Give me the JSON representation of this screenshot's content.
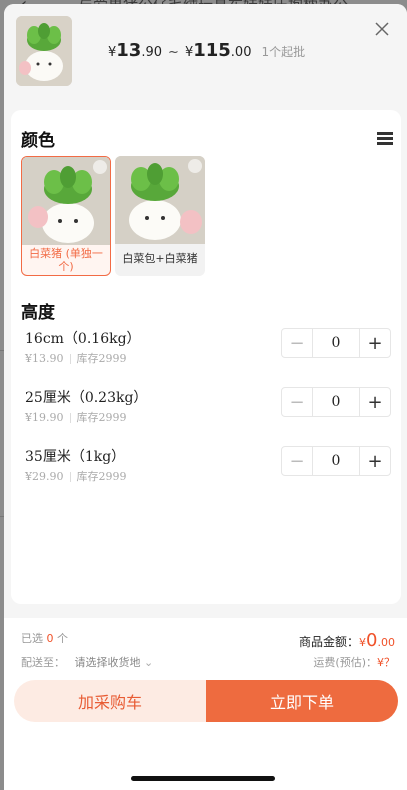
{
  "background": {
    "title": "与爱果猪公仔毛绒玩具布娃娃压抱枕办公..."
  },
  "header": {
    "price_min_symbol": "¥",
    "price_min_int": "13",
    "price_min_dec": ".90",
    "price_sep": "~",
    "price_max_symbol": "¥",
    "price_max_int": "115",
    "price_max_dec": ".00",
    "moq": "1个起批"
  },
  "color_section": {
    "title": "颜色",
    "options": [
      {
        "label": "白菜猪 (单独一个)",
        "selected": true
      },
      {
        "label": "白菜包+白菜猪",
        "selected": false
      }
    ]
  },
  "height_section": {
    "title": "高度",
    "rows": [
      {
        "name": "16cm（0.16kg）",
        "price": "¥13.90",
        "stock": "库存2999",
        "qty": "0"
      },
      {
        "name": "25厘米（0.23kg）",
        "price": "¥19.90",
        "stock": "库存2999",
        "qty": "0"
      },
      {
        "name": "35厘米（1kg）",
        "price": "¥29.90",
        "stock": "库存2999",
        "qty": "0"
      }
    ]
  },
  "footer": {
    "selected_prefix": "已选",
    "selected_count": "0",
    "selected_suffix": "个",
    "amount_label": "商品金额：",
    "amount_symbol": "¥",
    "amount_int": "0",
    "amount_dec": ".00",
    "ship_label": "配送至：",
    "ship_value": "请选择收货地",
    "freight_label": "运费(预估)：",
    "freight_value": "¥？"
  },
  "actions": {
    "cart": "加采购车",
    "buy": "立即下单"
  },
  "colors": {
    "accent": "#ee6b3f",
    "accent_light": "#fdebe3",
    "price_red": "#f0522a"
  },
  "icons": [
    "close-icon",
    "list-view-icon",
    "zoom-icon",
    "chevron-down-icon",
    "minus-icon",
    "plus-icon"
  ]
}
